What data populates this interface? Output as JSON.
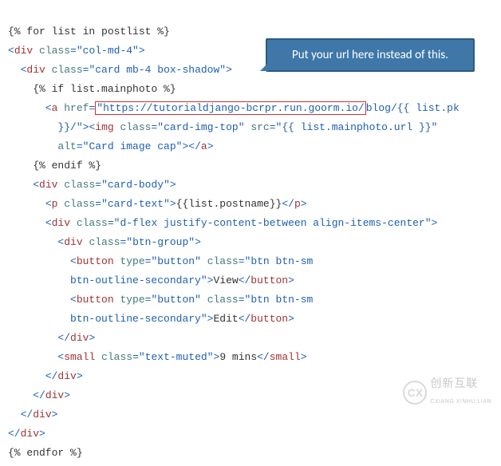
{
  "callout": "Put your url here instead of this.",
  "code": {
    "line1_for": "{% for list in postlist %}",
    "line2_div_open": "<",
    "line2_div_tag": "div",
    "line2_class_attr": " class",
    "line2_eq": "=",
    "line2_class_val": "\"col-md-4\"",
    "line2_close": ">",
    "line3_div_open": "<",
    "line3_div_tag": "div",
    "line3_class_attr": " class",
    "line3_eq": "=",
    "line3_class_val": "\"card mb-4 box-shadow\"",
    "line3_close": ">",
    "line4_if": "{% if list.mainphoto %}",
    "line5_a_open": "<",
    "line5_a_tag": "a",
    "line5_href_attr": " href",
    "line5_eq": "=",
    "line5_quote": "\"",
    "line5_url": "https://tutorialdjango-bcrpr.run.goorm.io/",
    "line5_blog": "blog/",
    "line5_listpk": "{{ list.pk",
    "line6_close": "}}/\"",
    "line6_gt": ">",
    "line6_img_open": "<",
    "line6_img_tag": "img",
    "line6_class_attr": " class",
    "line6_eq": "=",
    "line6_class_val": "\"card-img-top\"",
    "line6_src_attr": " src",
    "line6_eq2": "=",
    "line6_src_val": "\"{{ list.mainphoto.url }}\"",
    "line7_alt_attr": "alt",
    "line7_eq": "=",
    "line7_alt_val": "\"Card image cap\"",
    "line7_gt": ">",
    "line7_a_close_open": "</",
    "line7_a_close_tag": "a",
    "line7_a_close_gt": ">",
    "line8_endif": "{% endif %}",
    "line9_div_open": "<",
    "line9_div_tag": "div",
    "line9_class_attr": " class",
    "line9_eq": "=",
    "line9_class_val": "\"card-body\"",
    "line9_close": ">",
    "line10_p_open": "<",
    "line10_p_tag": "p",
    "line10_class_attr": " class",
    "line10_eq": "=",
    "line10_class_val": "\"card-text\"",
    "line10_gt": ">",
    "line10_content": "{{list.postname}}",
    "line10_pclose_open": "</",
    "line10_pclose_tag": "p",
    "line10_pclose_gt": ">",
    "line11_div_open": "<",
    "line11_div_tag": "div",
    "line11_class_attr": " class",
    "line11_eq": "=",
    "line11_class_val": "\"d-flex justify-content-between align-items-center\"",
    "line11_close": ">",
    "line12_div_open": "<",
    "line12_div_tag": "div",
    "line12_class_attr": " class",
    "line12_eq": "=",
    "line12_class_val": "\"btn-group\"",
    "line12_close": ">",
    "line13_btn_open": "<",
    "line13_btn_tag": "button",
    "line13_type_attr": " type",
    "line13_eq": "=",
    "line13_type_val": "\"button\"",
    "line13_class_attr": " class",
    "line13_eq2": "=",
    "line13_class_val": "\"btn btn-sm",
    "line14_class_val": "btn-outline-secondary\"",
    "line14_gt": ">",
    "line14_text": "View",
    "line14_close_open": "</",
    "line14_close_tag": "button",
    "line14_close_gt": ">",
    "line15_btn_open": "<",
    "line15_btn_tag": "button",
    "line15_type_attr": " type",
    "line15_eq": "=",
    "line15_type_val": "\"button\"",
    "line15_class_attr": " class",
    "line15_eq2": "=",
    "line15_class_val": "\"btn btn-sm",
    "line16_class_val": "btn-outline-secondary\"",
    "line16_gt": ">",
    "line16_text": "Edit",
    "line16_close_open": "</",
    "line16_close_tag": "button",
    "line16_close_gt": ">",
    "line17_divclose_open": "</",
    "line17_divclose_tag": "div",
    "line17_divclose_gt": ">",
    "line18_small_open": "<",
    "line18_small_tag": "small",
    "line18_class_attr": " class",
    "line18_eq": "=",
    "line18_class_val": "\"text-muted\"",
    "line18_gt": ">",
    "line18_text": "9 mins",
    "line18_close_open": "</",
    "line18_close_tag": "small",
    "line18_close_gt": ">",
    "line19_divclose_open": "</",
    "line19_divclose_tag": "div",
    "line19_divclose_gt": ">",
    "line20_divclose_open": "</",
    "line20_divclose_tag": "div",
    "line20_divclose_gt": ">",
    "line21_divclose_open": "</",
    "line21_divclose_tag": "div",
    "line21_divclose_gt": ">",
    "line22_divclose_open": "</",
    "line22_divclose_tag": "div",
    "line22_divclose_gt": ">",
    "line23_endfor": "{% endfor %}"
  },
  "logo": {
    "icon": "CX",
    "cn": "创新互联",
    "en": "CXIANG XINHU LIAN"
  }
}
